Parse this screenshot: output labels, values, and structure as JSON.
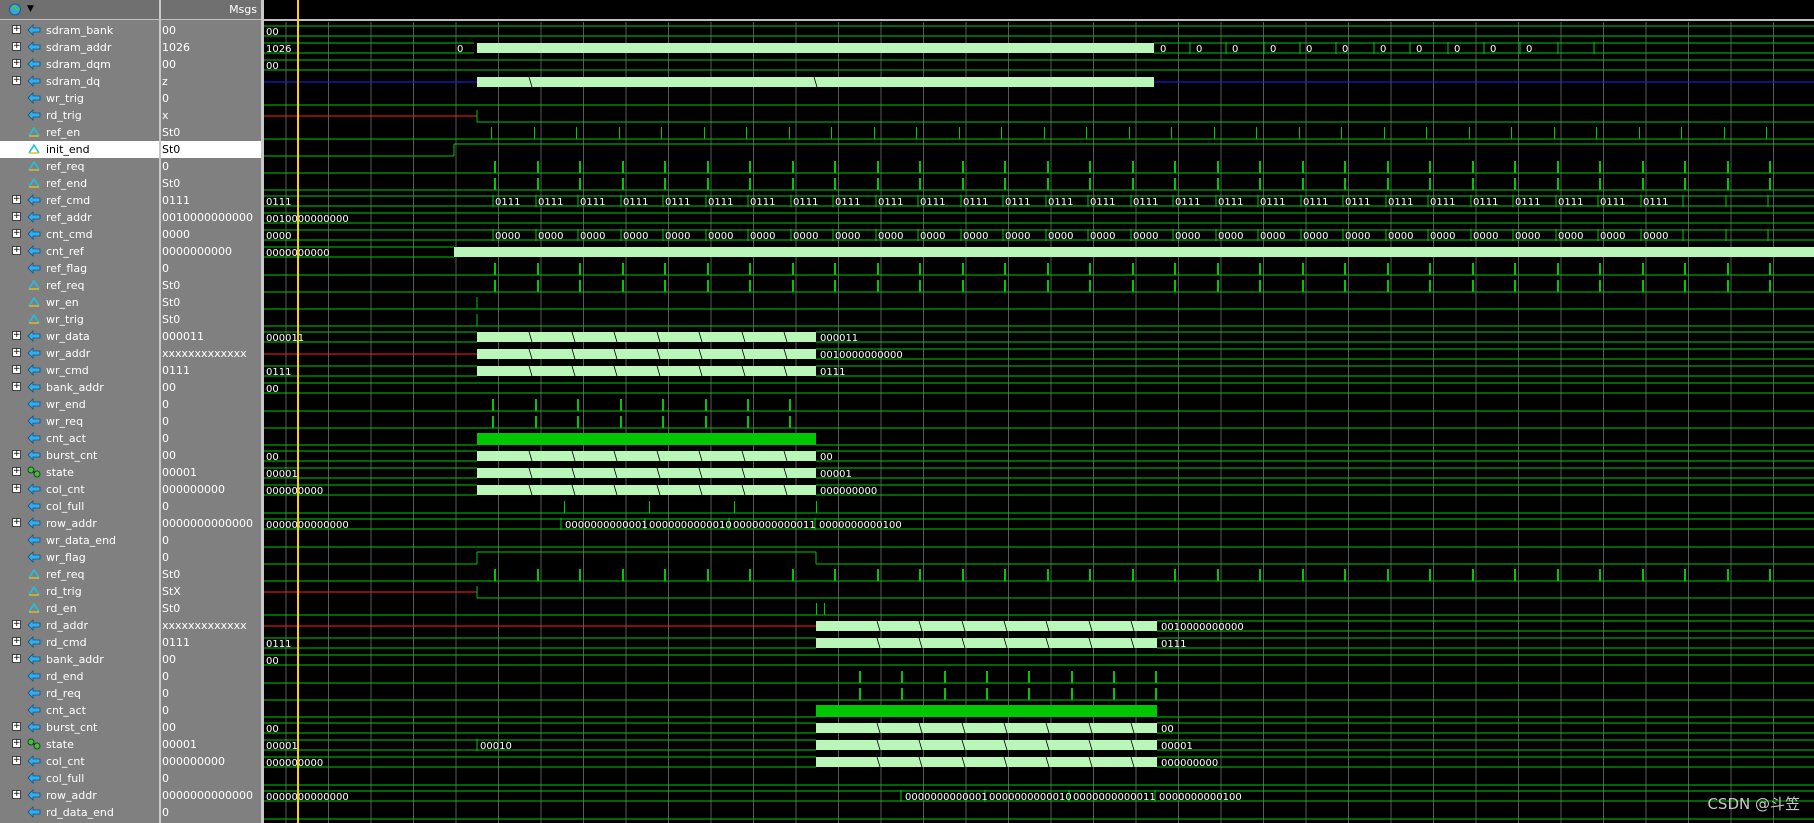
{
  "window": {
    "values_header": "Msgs",
    "toolbar_icon": "wave-toolbar-icon",
    "watermark": "CSDN @斗笠"
  },
  "colors": {
    "wave_green": "#00c800",
    "bus_fill": "#b8f7b8",
    "undefined_red": "#ff2020",
    "hiz_blue": "#2020ff",
    "cursor_yellow": "#ffd000",
    "grid": "#595959"
  },
  "signals": [
    {
      "name": "sdram_bank",
      "value": "00",
      "expandable": true,
      "icon": "bus-port-icon"
    },
    {
      "name": "sdram_addr",
      "value": "1026",
      "expandable": true,
      "icon": "bus-port-icon"
    },
    {
      "name": "sdram_dqm",
      "value": "00",
      "expandable": true,
      "icon": "bus-port-icon"
    },
    {
      "name": "sdram_dq",
      "value": "z",
      "expandable": true,
      "icon": "bus-port-icon"
    },
    {
      "name": "wr_trig",
      "value": "0",
      "expandable": false,
      "icon": "port-icon"
    },
    {
      "name": "rd_trig",
      "value": "x",
      "expandable": false,
      "icon": "port-icon"
    },
    {
      "name": "ref_en",
      "value": "St0",
      "expandable": false,
      "icon": "net-icon"
    },
    {
      "name": "init_end",
      "value": "St0",
      "expandable": false,
      "icon": "net-icon",
      "selected": true
    },
    {
      "name": "ref_req",
      "value": "0",
      "expandable": false,
      "icon": "net-icon"
    },
    {
      "name": "ref_end",
      "value": "St0",
      "expandable": false,
      "icon": "net-icon"
    },
    {
      "name": "ref_cmd",
      "value": "0111",
      "expandable": true,
      "icon": "bus-port-icon"
    },
    {
      "name": "ref_addr",
      "value": "0010000000000",
      "expandable": true,
      "icon": "bus-port-icon"
    },
    {
      "name": "cnt_cmd",
      "value": "0000",
      "expandable": true,
      "icon": "bus-port-icon"
    },
    {
      "name": "cnt_ref",
      "value": "0000000000",
      "expandable": true,
      "icon": "bus-port-icon"
    },
    {
      "name": "ref_flag",
      "value": "0",
      "expandable": false,
      "icon": "port-icon"
    },
    {
      "name": "ref_req",
      "value": "St0",
      "expandable": false,
      "icon": "net-icon"
    },
    {
      "name": "wr_en",
      "value": "St0",
      "expandable": false,
      "icon": "net-icon"
    },
    {
      "name": "wr_trig",
      "value": "St0",
      "expandable": false,
      "icon": "net-icon"
    },
    {
      "name": "wr_data",
      "value": "000011",
      "expandable": true,
      "icon": "bus-port-icon"
    },
    {
      "name": "wr_addr",
      "value": "xxxxxxxxxxxxx",
      "expandable": true,
      "icon": "bus-port-icon"
    },
    {
      "name": "wr_cmd",
      "value": "0111",
      "expandable": true,
      "icon": "bus-port-icon"
    },
    {
      "name": "bank_addr",
      "value": "00",
      "expandable": true,
      "icon": "bus-port-icon"
    },
    {
      "name": "wr_end",
      "value": "0",
      "expandable": false,
      "icon": "port-icon"
    },
    {
      "name": "wr_req",
      "value": "0",
      "expandable": false,
      "icon": "port-icon"
    },
    {
      "name": "cnt_act",
      "value": "0",
      "expandable": false,
      "icon": "port-icon"
    },
    {
      "name": "burst_cnt",
      "value": "00",
      "expandable": true,
      "icon": "bus-port-icon"
    },
    {
      "name": "state",
      "value": "00001",
      "expandable": true,
      "icon": "state-machine-icon"
    },
    {
      "name": "col_cnt",
      "value": "000000000",
      "expandable": true,
      "icon": "bus-port-icon"
    },
    {
      "name": "col_full",
      "value": "0",
      "expandable": false,
      "icon": "port-icon"
    },
    {
      "name": "row_addr",
      "value": "0000000000000",
      "expandable": true,
      "icon": "bus-port-icon"
    },
    {
      "name": "wr_data_end",
      "value": "0",
      "expandable": false,
      "icon": "port-icon"
    },
    {
      "name": "wr_flag",
      "value": "0",
      "expandable": false,
      "icon": "port-icon"
    },
    {
      "name": "ref_req",
      "value": "St0",
      "expandable": false,
      "icon": "net-icon"
    },
    {
      "name": "rd_trig",
      "value": "StX",
      "expandable": false,
      "icon": "net-icon"
    },
    {
      "name": "rd_en",
      "value": "St0",
      "expandable": false,
      "icon": "net-icon"
    },
    {
      "name": "rd_addr",
      "value": "xxxxxxxxxxxxx",
      "expandable": true,
      "icon": "bus-port-icon"
    },
    {
      "name": "rd_cmd",
      "value": "0111",
      "expandable": true,
      "icon": "bus-port-icon"
    },
    {
      "name": "bank_addr",
      "value": "00",
      "expandable": true,
      "icon": "bus-port-icon"
    },
    {
      "name": "rd_end",
      "value": "0",
      "expandable": false,
      "icon": "port-icon"
    },
    {
      "name": "rd_req",
      "value": "0",
      "expandable": false,
      "icon": "port-icon"
    },
    {
      "name": "cnt_act",
      "value": "0",
      "expandable": false,
      "icon": "port-icon"
    },
    {
      "name": "burst_cnt",
      "value": "00",
      "expandable": true,
      "icon": "bus-port-icon"
    },
    {
      "name": "state",
      "value": "00001",
      "expandable": true,
      "icon": "state-machine-icon"
    },
    {
      "name": "col_cnt",
      "value": "000000000",
      "expandable": true,
      "icon": "bus-port-icon"
    },
    {
      "name": "col_full",
      "value": "0",
      "expandable": false,
      "icon": "port-icon"
    },
    {
      "name": "row_addr",
      "value": "0000000000000",
      "expandable": true,
      "icon": "bus-port-icon"
    },
    {
      "name": "rd_data_end",
      "value": "0",
      "expandable": false,
      "icon": "port-icon"
    }
  ],
  "wave_labels": [
    {
      "row": 0,
      "text": "00"
    },
    {
      "row": 1,
      "text": "1026"
    },
    {
      "row": 1,
      "text": "0"
    },
    {
      "row": 1,
      "text": "0"
    },
    {
      "row": 1,
      "text": "0"
    },
    {
      "row": 1,
      "text": "0"
    },
    {
      "row": 1,
      "text": "0"
    },
    {
      "row": 1,
      "text": "0"
    },
    {
      "row": 1,
      "text": "0"
    },
    {
      "row": 1,
      "text": "0"
    },
    {
      "row": 1,
      "text": "0"
    },
    {
      "row": 1,
      "text": "0"
    },
    {
      "row": 1,
      "text": "0"
    },
    {
      "row": 1,
      "text": "0"
    },
    {
      "row": 2,
      "text": "00"
    },
    {
      "row": 10,
      "text": "0111"
    },
    {
      "row": 10,
      "text": "0111"
    },
    {
      "row": 10,
      "text": "0111"
    },
    {
      "row": 10,
      "text": "0111"
    },
    {
      "row": 10,
      "text": "0111"
    },
    {
      "row": 10,
      "text": "0111"
    },
    {
      "row": 10,
      "text": "0111"
    },
    {
      "row": 10,
      "text": "0111"
    },
    {
      "row": 10,
      "text": "0111"
    },
    {
      "row": 10,
      "text": "0111"
    },
    {
      "row": 10,
      "text": "0111"
    },
    {
      "row": 10,
      "text": "0111"
    },
    {
      "row": 10,
      "text": "0111"
    },
    {
      "row": 10,
      "text": "0111"
    },
    {
      "row": 10,
      "text": "0111"
    },
    {
      "row": 10,
      "text": "0111"
    },
    {
      "row": 10,
      "text": "0111"
    },
    {
      "row": 10,
      "text": "0111"
    },
    {
      "row": 10,
      "text": "0111"
    },
    {
      "row": 10,
      "text": "0111"
    },
    {
      "row": 10,
      "text": "0111"
    },
    {
      "row": 10,
      "text": "0111"
    },
    {
      "row": 10,
      "text": "0111"
    },
    {
      "row": 10,
      "text": "0111"
    },
    {
      "row": 10,
      "text": "0111"
    },
    {
      "row": 10,
      "text": "0111"
    },
    {
      "row": 10,
      "text": "0111"
    },
    {
      "row": 10,
      "text": "0111"
    },
    {
      "row": 10,
      "text": "0111"
    },
    {
      "row": 11,
      "text": "0010000000000"
    },
    {
      "row": 12,
      "text": "0000"
    },
    {
      "row": 12,
      "text": "0000"
    },
    {
      "row": 12,
      "text": "0000"
    },
    {
      "row": 12,
      "text": "0000"
    },
    {
      "row": 12,
      "text": "0000"
    },
    {
      "row": 12,
      "text": "0000"
    },
    {
      "row": 12,
      "text": "0000"
    },
    {
      "row": 12,
      "text": "0000"
    },
    {
      "row": 12,
      "text": "0000"
    },
    {
      "row": 12,
      "text": "0000"
    },
    {
      "row": 12,
      "text": "0000"
    },
    {
      "row": 12,
      "text": "0000"
    },
    {
      "row": 12,
      "text": "0000"
    },
    {
      "row": 12,
      "text": "0000"
    },
    {
      "row": 12,
      "text": "0000"
    },
    {
      "row": 12,
      "text": "0000"
    },
    {
      "row": 12,
      "text": "0000"
    },
    {
      "row": 12,
      "text": "0000"
    },
    {
      "row": 12,
      "text": "0000"
    },
    {
      "row": 12,
      "text": "0000"
    },
    {
      "row": 12,
      "text": "0000"
    },
    {
      "row": 12,
      "text": "0000"
    },
    {
      "row": 12,
      "text": "0000"
    },
    {
      "row": 12,
      "text": "0000"
    },
    {
      "row": 12,
      "text": "0000"
    },
    {
      "row": 12,
      "text": "0000"
    },
    {
      "row": 12,
      "text": "0000"
    },
    {
      "row": 12,
      "text": "0000"
    },
    {
      "row": 12,
      "text": "0000"
    },
    {
      "row": 13,
      "text": "0000000000"
    },
    {
      "row": 18,
      "text": "000011"
    },
    {
      "row": 18,
      "text": "000011"
    },
    {
      "row": 19,
      "text": "0010000000000"
    },
    {
      "row": 20,
      "text": "0111"
    },
    {
      "row": 20,
      "text": "0111"
    },
    {
      "row": 21,
      "text": "00"
    },
    {
      "row": 25,
      "text": "00"
    },
    {
      "row": 25,
      "text": "00"
    },
    {
      "row": 26,
      "text": "00001"
    },
    {
      "row": 26,
      "text": "00001"
    },
    {
      "row": 27,
      "text": "000000000"
    },
    {
      "row": 27,
      "text": "000000000"
    },
    {
      "row": 29,
      "text": "0000000000000"
    },
    {
      "row": 29,
      "text": "0000000000001"
    },
    {
      "row": 29,
      "text": "0000000000010"
    },
    {
      "row": 29,
      "text": "0000000000011"
    },
    {
      "row": 29,
      "text": "0000000000100"
    },
    {
      "row": 35,
      "text": "0010000000000"
    },
    {
      "row": 36,
      "text": "0111"
    },
    {
      "row": 36,
      "text": "0111"
    },
    {
      "row": 37,
      "text": "00"
    },
    {
      "row": 41,
      "text": "00"
    },
    {
      "row": 41,
      "text": "00"
    },
    {
      "row": 42,
      "text": "00001"
    },
    {
      "row": 42,
      "text": "00010"
    },
    {
      "row": 42,
      "text": "00001"
    },
    {
      "row": 43,
      "text": "000000000"
    },
    {
      "row": 43,
      "text": "000000000"
    },
    {
      "row": 45,
      "text": "0000000000000"
    },
    {
      "row": 45,
      "text": "0000000000001"
    },
    {
      "row": 45,
      "text": "0000000000010"
    },
    {
      "row": 45,
      "text": "0000000000011"
    },
    {
      "row": 45,
      "text": "0000000000100"
    }
  ]
}
